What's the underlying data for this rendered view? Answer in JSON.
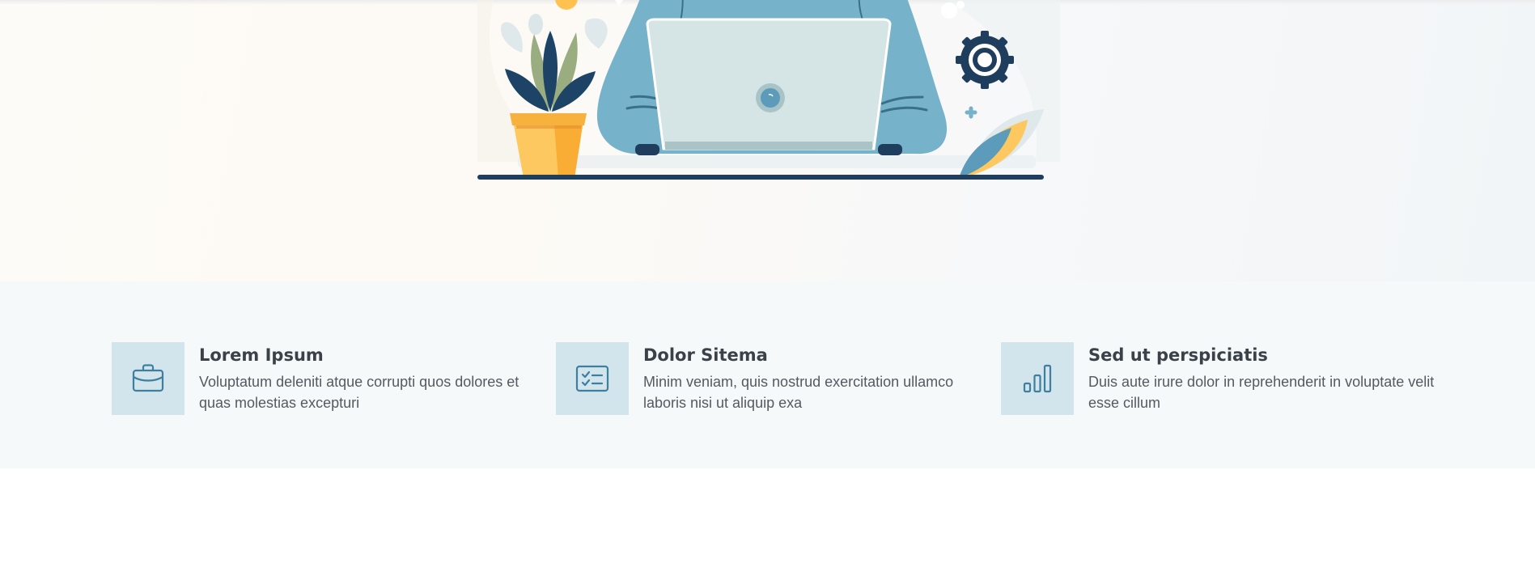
{
  "features": [
    {
      "title": "Lorem Ipsum",
      "description": "Voluptatum deleniti atque corrupti quos dolores et quas molestias excepturi",
      "icon": "briefcase-icon"
    },
    {
      "title": "Dolor Sitema",
      "description": "Minim veniam, quis nostrud exercitation ullamco laboris nisi ut aliquip exa",
      "icon": "checklist-card-icon"
    },
    {
      "title": "Sed ut perspiciatis",
      "description": "Duis aute irure dolor in reprehenderit in voluptate velit esse cillum",
      "icon": "bar-chart-icon"
    }
  ],
  "colors": {
    "icon_stroke": "#3e7fa0",
    "icon_box_bg": "#d2e5ec",
    "section_bg": "#f5f9fa",
    "heading": "#3b4148"
  }
}
